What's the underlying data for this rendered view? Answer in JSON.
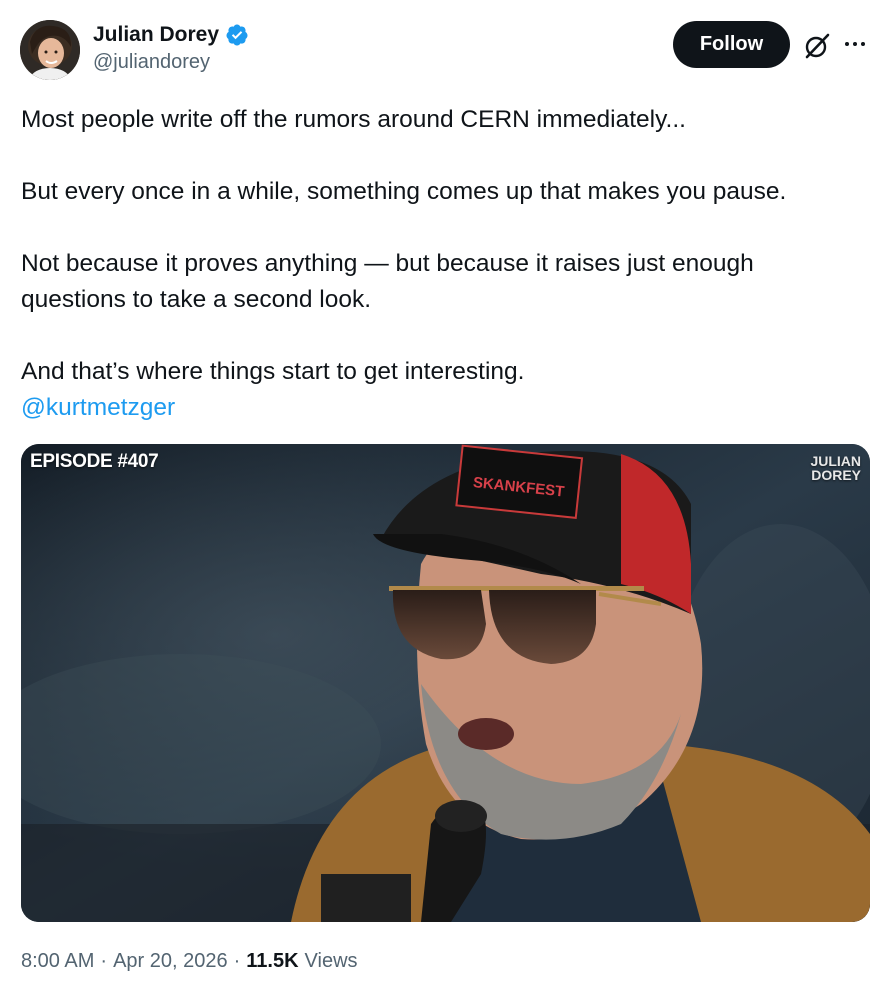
{
  "author": {
    "name": "Julian Dorey",
    "handle": "@juliandorey",
    "verified": true,
    "verified_color": "#1d9bf0"
  },
  "actions": {
    "follow_label": "Follow",
    "grok_icon": "grok-icon",
    "more_icon": "more-icon"
  },
  "tweet": {
    "paragraphs": [
      "Most people write off the rumors around CERN immediately...",
      "But every once in a while, something comes up that makes you pause.",
      "Not because it proves anything — but because it raises just enough questions to take a second look.",
      "And that’s where things start to get interesting."
    ],
    "mention": "@kurtmetzger"
  },
  "media": {
    "episode_label": "EPISODE #407",
    "brand_line1": "JULIAN",
    "brand_line2": "DOREY",
    "hat_text": "SKANKFEST"
  },
  "meta": {
    "time": "8:00 AM",
    "separator": "·",
    "date": "Apr 20, 2026",
    "views_count": "11.5K",
    "views_label": "Views"
  },
  "colors": {
    "text": "#0f1419",
    "secondary": "#536471",
    "link": "#1d9bf0",
    "follow_bg": "#0f1419"
  }
}
